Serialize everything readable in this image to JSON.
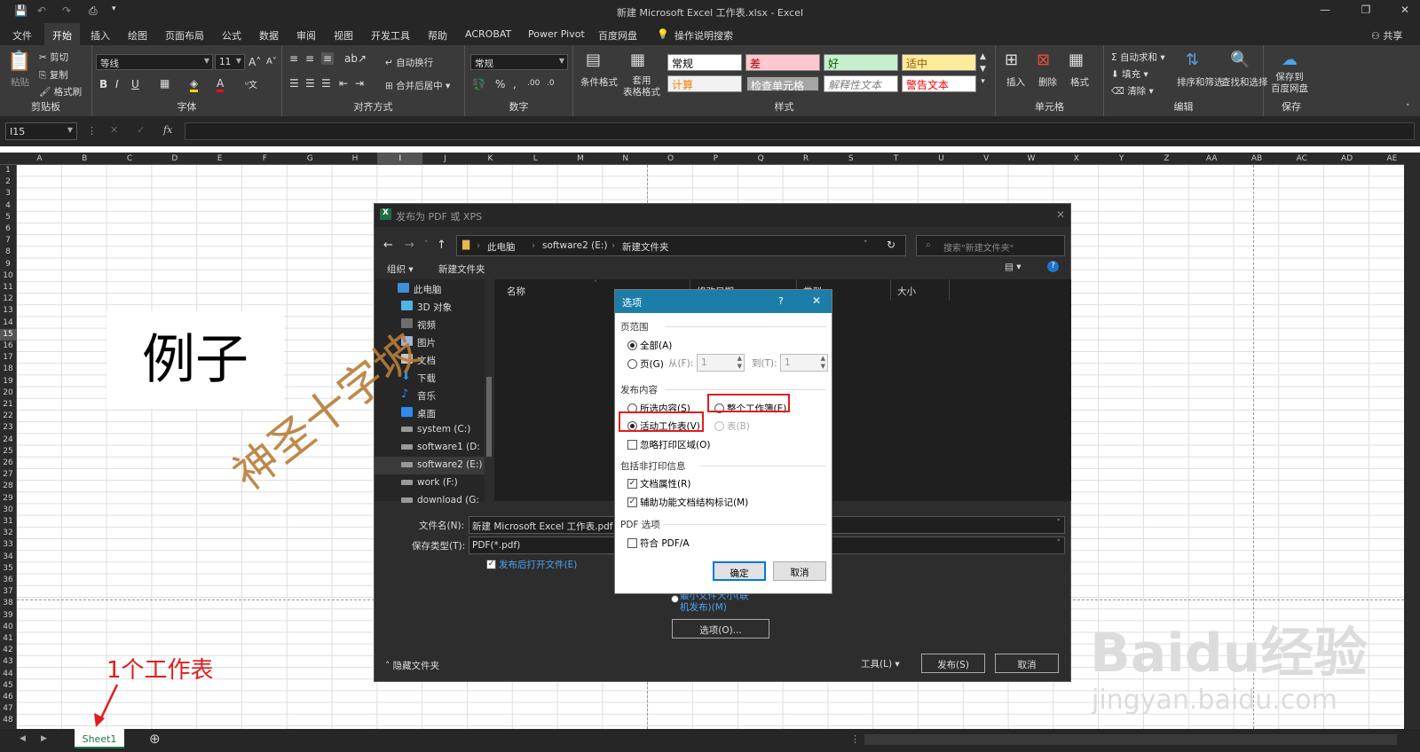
{
  "window": {
    "title": "新建 Microsoft Excel 工作表.xlsx  -  Excel"
  },
  "menu": {
    "tabs": [
      "文件",
      "开始",
      "插入",
      "绘图",
      "页面布局",
      "公式",
      "数据",
      "审阅",
      "视图",
      "开发工具",
      "帮助",
      "ACROBAT",
      "Power Pivot",
      "百度网盘"
    ],
    "search": "操作说明搜索",
    "share": "共享"
  },
  "ribbon": {
    "clipboard": {
      "paste": "粘贴",
      "cut": "剪切",
      "copy": "复制",
      "format_painter": "格式刷",
      "label": "剪贴板"
    },
    "font": {
      "name": "等线",
      "size": "11",
      "label": "字体"
    },
    "alignment": {
      "wrap": "自动换行",
      "merge": "合并后居中",
      "label": "对齐方式"
    },
    "number": {
      "format": "常规",
      "label": "数字"
    },
    "styles": {
      "cond_format": "条件格式",
      "table_format": "套用\n表格格式",
      "cells": [
        "常规",
        "差",
        "好",
        "适中",
        "计算",
        "检查单元格",
        "解释性文本",
        "警告文本"
      ],
      "label": "样式"
    },
    "cells_grp": {
      "insert": "插入",
      "delete": "删除",
      "format": "格式",
      "label": "单元格"
    },
    "editing": {
      "autosum": "自动求和",
      "fill": "填充",
      "clear": "清除",
      "sort": "排序和筛选",
      "find": "查找和选择",
      "label": "编辑"
    },
    "save": {
      "button": "保存到\n百度网盘",
      "label": "保存"
    }
  },
  "formula_bar": {
    "name_box": "I15",
    "fx": "fx"
  },
  "sheet": {
    "columns": [
      "A",
      "B",
      "C",
      "D",
      "E",
      "F",
      "G",
      "H",
      "I",
      "J",
      "K",
      "L",
      "M",
      "N",
      "O",
      "P",
      "Q",
      "R",
      "S",
      "T",
      "U",
      "V",
      "W",
      "X",
      "Y",
      "Z",
      "AA",
      "AB",
      "AC",
      "AD",
      "AE"
    ],
    "rows": [
      "1",
      "2",
      "3",
      "4",
      "5",
      "6",
      "7",
      "8",
      "9",
      "10",
      "11",
      "12",
      "13",
      "14",
      "15",
      "16",
      "17",
      "18",
      "19",
      "20",
      "21",
      "22",
      "23",
      "24",
      "25",
      "26",
      "27",
      "28",
      "29",
      "30",
      "31",
      "32",
      "33",
      "34",
      "35",
      "36",
      "37",
      "38",
      "39",
      "40",
      "41",
      "42",
      "43",
      "44",
      "45",
      "46",
      "47",
      "48"
    ],
    "example_text": "例子",
    "tab": "Sheet1"
  },
  "publish_dialog": {
    "title": "发布为 PDF 或 XPS",
    "breadcrumb": [
      "此电脑",
      "software2 (E:)",
      "新建文件夹"
    ],
    "search_placeholder": "搜索\"新建文件夹\"",
    "organize": "组织",
    "new_folder": "新建文件夹",
    "nav": [
      "此电脑",
      "3D 对象",
      "视频",
      "图片",
      "文档",
      "下载",
      "音乐",
      "桌面",
      "system (C:)",
      "software1 (D:",
      "software2 (E:)",
      "work (F:)",
      "download (G:"
    ],
    "columns": [
      "名称",
      "修改日期",
      "类型",
      "大小"
    ],
    "filename_label": "文件名(N):",
    "filename": "新建 Microsoft Excel 工作表.pdf",
    "savetype_label": "保存类型(T):",
    "savetype": "PDF(*.pdf)",
    "open_after": "发布后打开文件(E)",
    "min_size": "最小文件大小(联机发布)(M)",
    "options_btn": "选项(O)...",
    "hide_folders": "隐藏文件夹",
    "tools": "工具(L)",
    "publish": "发布(S)",
    "cancel": "取消"
  },
  "options_dialog": {
    "title": "选项",
    "help": "?",
    "page_range": "页范围",
    "all": "全部(A)",
    "pages": "页(G)",
    "from": "从(F):",
    "from_val": "1",
    "to": "到(T):",
    "to_val": "1",
    "publish_what": "发布内容",
    "selection": "所选内容(S)",
    "entire_workbook": "整个工作簿(E)",
    "active_sheets": "活动工作表(V)",
    "table": "表(B)",
    "ignore_print_areas": "忽略打印区域(O)",
    "non_print_info": "包括非打印信息",
    "doc_properties": "文档属性(R)",
    "accessibility_tags": "辅助功能文档结构标记(M)",
    "pdf_options": "PDF 选项",
    "pdfa": "符合 PDF/A",
    "ok": "确定",
    "cancel": "取消"
  },
  "annotations": {
    "watermark": "神圣十字坡",
    "note": "1个工作表",
    "baidu_logo": "Baidu经验",
    "baidu_url": "jingyan.baidu.com"
  }
}
